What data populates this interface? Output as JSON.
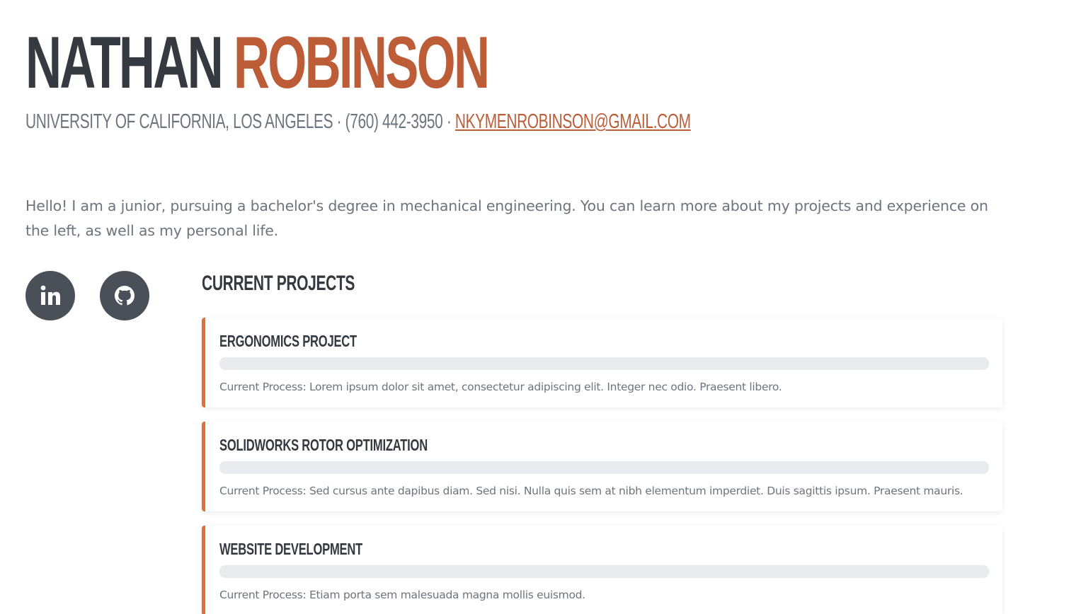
{
  "header": {
    "first_name": "NATHAN",
    "last_name": "ROBINSON",
    "university": "UNIVERSITY OF CALIFORNIA, LOS ANGELES",
    "separator": " · ",
    "phone": "(760) 442-3950",
    "email": "NKYMENROBINSON@GMAIL.COM"
  },
  "intro": "Hello! I am a junior, pursuing a bachelor's degree in mechanical engineering. You can learn more about my projects and experience on the left, as well as my personal life.",
  "social": [
    {
      "icon": "linkedin-icon"
    },
    {
      "icon": "github-icon"
    }
  ],
  "projects": {
    "title": "CURRENT PROJECTS",
    "items": [
      {
        "title": "ERGONOMICS PROJECT",
        "progress": 0,
        "description": "Current Process: Lorem ipsum dolor sit amet, consectetur adipiscing elit. Integer nec odio. Praesent libero."
      },
      {
        "title": "SOLIDWORKS ROTOR OPTIMIZATION",
        "progress": 0,
        "description": "Current Process: Sed cursus ante dapibus diam. Sed nisi. Nulla quis sem at nibh elementum imperdiet. Duis sagittis ipsum. Praesent mauris."
      },
      {
        "title": "WEBSITE DEVELOPMENT",
        "progress": 0,
        "description": "Current Process: Etiam porta sem malesuada magna mollis euismod."
      }
    ]
  },
  "colors": {
    "accent": "#bd5d38",
    "card_border": "#e56f2e",
    "heading": "#343a40",
    "text": "#6c757d",
    "social_bg": "#495057",
    "progress_track": "#e9ecef"
  }
}
